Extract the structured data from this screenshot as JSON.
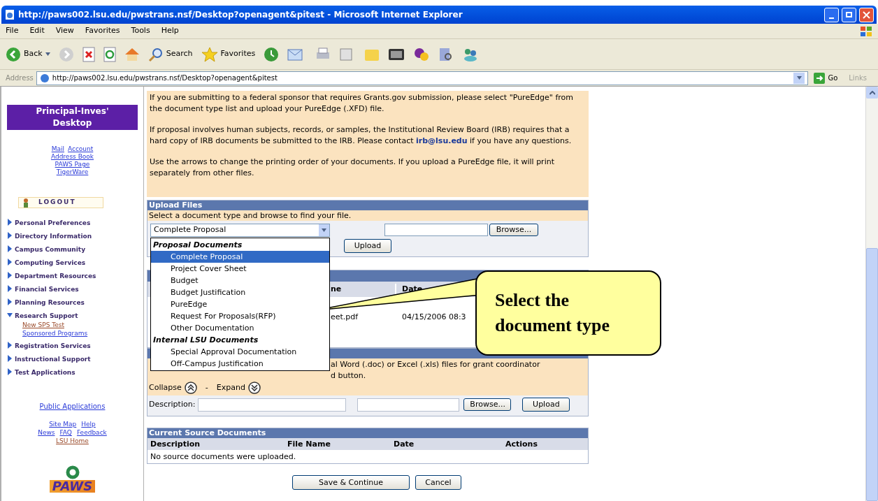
{
  "window": {
    "title": "http://paws002.lsu.edu/pwstrans.nsf/Desktop?openagent&pitest - Microsoft Internet Explorer"
  },
  "menu": [
    "File",
    "Edit",
    "View",
    "Favorites",
    "Tools",
    "Help"
  ],
  "toolbar": {
    "back": "Back",
    "search": "Search",
    "favorites": "Favorites"
  },
  "address": {
    "label": "Address",
    "url": "http://paws002.lsu.edu/pwstrans.nsf/Desktop?openagent&pitest",
    "go": "Go",
    "links": "Links"
  },
  "sidebar": {
    "title": "Principal-Inves' Desktop",
    "top_links": [
      [
        "Mail",
        "Account"
      ],
      [
        "Address Book"
      ],
      [
        "PAWS Page"
      ],
      [
        "TigerWare"
      ]
    ],
    "logout": "LOGOUT",
    "nav": [
      {
        "label": "Personal Preferences",
        "expanded": false
      },
      {
        "label": "Directory Information",
        "expanded": false
      },
      {
        "label": "Campus Community",
        "expanded": false
      },
      {
        "label": "Computing Services",
        "expanded": false
      },
      {
        "label": "Department Resources",
        "expanded": false
      },
      {
        "label": "Financial Services",
        "expanded": false
      },
      {
        "label": "Planning Resources",
        "expanded": false
      },
      {
        "label": "Research Support",
        "expanded": true,
        "children": [
          {
            "label": "New SPS Test",
            "visited": true
          },
          {
            "label": "Sponsored Programs",
            "visited": false
          }
        ]
      },
      {
        "label": "Registration Services",
        "expanded": false
      },
      {
        "label": "Instructional Support",
        "expanded": false
      },
      {
        "label": "Test Applications",
        "expanded": false
      }
    ],
    "public_link": "Public Applications",
    "bottom_links": [
      [
        {
          "label": "Site Map",
          "visited": false
        },
        {
          "label": "Help",
          "visited": false
        }
      ],
      [
        {
          "label": "News",
          "visited": false
        },
        {
          "label": "FAQ",
          "visited": false
        },
        {
          "label": "Feedback",
          "visited": false
        }
      ],
      [
        {
          "label": "LSU Home",
          "visited": true
        }
      ]
    ],
    "logo": "PAWS"
  },
  "info": [
    {
      "text": "If you are submitting to a federal sponsor that requires Grants.gov submission, please select \"PureEdge\" from the document type list and upload your PureEdge (.XFD) file."
    },
    {
      "text": "If proposal involves human subjects, records, or samples, the Institutional Review Board (IRB) requires that a hard copy of IRB documents be submitted to the IRB. Please contact",
      "link": "irb@lsu.edu",
      "after": "if you have any questions."
    },
    {
      "text": "Use the arrows to change the printing order of your documents. If you upload a PureEdge file, it will print separately from other files."
    }
  ],
  "upload": {
    "title": "Upload Files",
    "instruction": "Select a document type and browse to find your file.",
    "select_value": "Complete Proposal",
    "browse": "Browse...",
    "upload": "Upload"
  },
  "dropdown": [
    {
      "group": "Proposal Documents",
      "options": [
        {
          "label": "Complete Proposal",
          "selected": true
        },
        {
          "label": "Project Cover Sheet",
          "selected": false
        },
        {
          "label": "Budget",
          "selected": false
        },
        {
          "label": "Budget Justification",
          "selected": false
        },
        {
          "label": "PureEdge",
          "selected": false
        },
        {
          "label": "Request For Proposals(RFP)",
          "selected": false
        },
        {
          "label": "Other Documentation",
          "selected": false
        }
      ]
    },
    {
      "group": "Internal LSU Documents",
      "options": [
        {
          "label": "Special Approval Documentation",
          "selected": false
        },
        {
          "label": "Off-Campus Justification",
          "selected": false
        }
      ]
    }
  ],
  "documents_table": {
    "columns": [
      "ne",
      "Date"
    ],
    "rows": [
      [
        "eet.pdf",
        "04/15/2006 08:3"
      ]
    ]
  },
  "source_upload": {
    "lines": [
      "al Word (.doc) or Excel (.xls) files for grant coordinator",
      "d button."
    ],
    "collapse": "Collapse",
    "separator": "-",
    "expand": "Expand",
    "description_label": "Description:",
    "browse": "Browse...",
    "upload": "Upload"
  },
  "current_sources": {
    "title": "Current Source Documents",
    "columns": [
      "Description",
      "File Name",
      "Date",
      "Actions"
    ],
    "empty": "No source documents were uploaded."
  },
  "buttons": [
    "Save & Continue",
    "Cancel"
  ],
  "callout": [
    "Select the",
    "document type"
  ]
}
